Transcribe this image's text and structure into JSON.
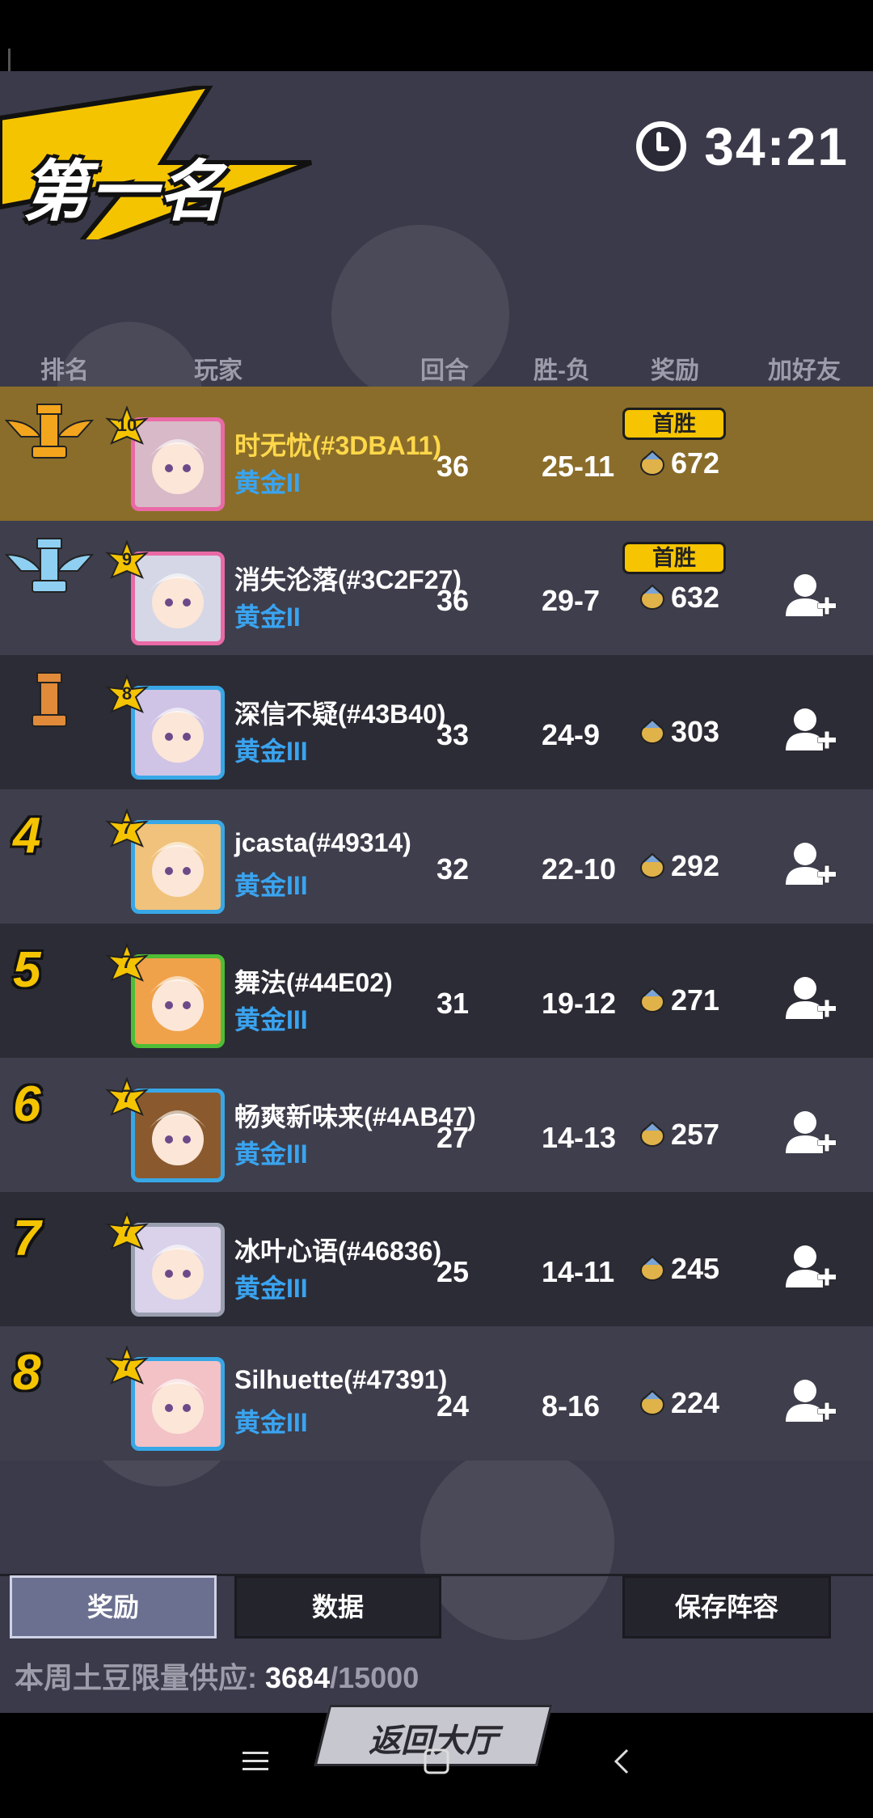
{
  "screen": {
    "banner_title": "第一名",
    "timer": "34:21"
  },
  "columns": {
    "rank": "排名",
    "player": "玩家",
    "rounds": "回合",
    "win_loss": "胜-负",
    "reward": "奖励",
    "add_friend": "加好友"
  },
  "first_win_label": "首胜",
  "rows": [
    {
      "rank": "1",
      "level": "10",
      "name": "时无忧(#3DBA11)",
      "tier": "黄金II",
      "rounds": "36",
      "win_loss": "25-11",
      "reward": "672",
      "first_win": true,
      "add_friend": false
    },
    {
      "rank": "2",
      "level": "9",
      "name": "消失沦落(#3C2F27)",
      "tier": "黄金II",
      "rounds": "36",
      "win_loss": "29-7",
      "reward": "632",
      "first_win": true,
      "add_friend": true
    },
    {
      "rank": "3",
      "level": "8",
      "name": "深信不疑(#43B40)",
      "tier": "黄金III",
      "rounds": "33",
      "win_loss": "24-9",
      "reward": "303",
      "first_win": false,
      "add_friend": true
    },
    {
      "rank": "4",
      "level": "7",
      "name": "jcasta(#49314)",
      "tier": "黄金III",
      "rounds": "32",
      "win_loss": "22-10",
      "reward": "292",
      "first_win": false,
      "add_friend": true
    },
    {
      "rank": "5",
      "level": "7",
      "name": "舞法(#44E02)",
      "tier": "黄金III",
      "rounds": "31",
      "win_loss": "19-12",
      "reward": "271",
      "first_win": false,
      "add_friend": true
    },
    {
      "rank": "6",
      "level": "7",
      "name": "畅爽新味来(#4AB47)",
      "tier": "黄金III",
      "rounds": "27",
      "win_loss": "14-13",
      "reward": "257",
      "first_win": false,
      "add_friend": true
    },
    {
      "rank": "7",
      "level": "7",
      "name": "冰叶心语(#46836)",
      "tier": "黄金III",
      "rounds": "25",
      "win_loss": "14-11",
      "reward": "245",
      "first_win": false,
      "add_friend": true
    },
    {
      "rank": "8",
      "level": "7",
      "name": "Silhuette(#47391)",
      "tier": "黄金III",
      "rounds": "24",
      "win_loss": "8-16",
      "reward": "224",
      "first_win": false,
      "add_friend": true
    }
  ],
  "bottom": {
    "tab_reward": "奖励",
    "tab_data": "数据",
    "save_lineup": "保存阵容",
    "supply_label": "本周土豆限量供应:",
    "supply_current": "3684",
    "supply_max": "/15000",
    "back_lobby": "返回大厅"
  },
  "colors": {
    "gold": "#f5c400",
    "tier_blue": "#3aa4f0",
    "first_row": "#8a6d2a"
  }
}
